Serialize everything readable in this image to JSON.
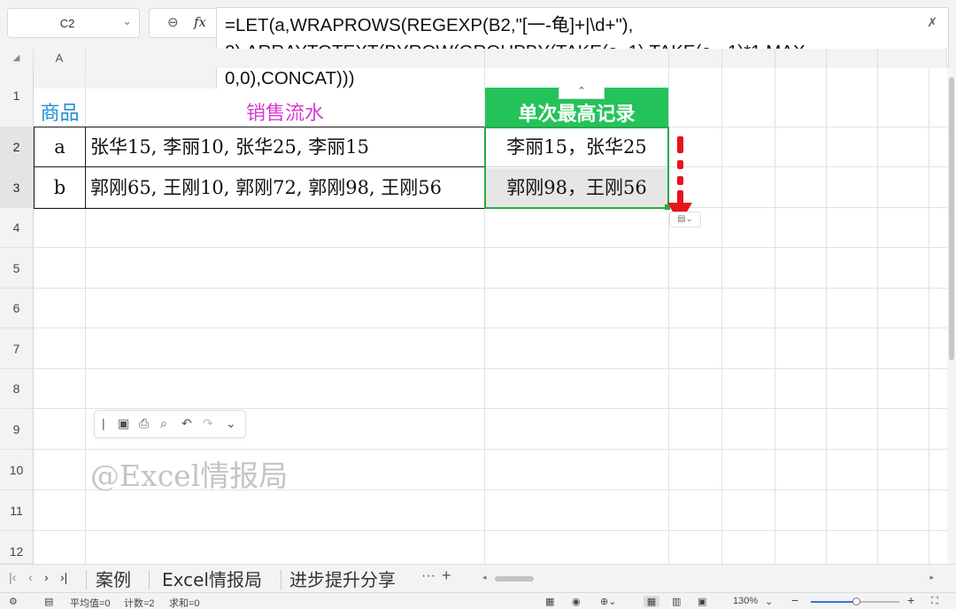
{
  "name_box": {
    "value": "C2"
  },
  "formula_bar": {
    "formula_line1": "=LET(a,WRAPROWS(REGEXP(B2,\"[一-龟]+|\\d+\"),",
    "formula_line2": "2),ARRAYTOTEXT(BYROW(GROUPBY(TAKE(a,,1),TAKE(a,,-1)*1,MAX,",
    "formula_line3": "0,0),CONCAT)))"
  },
  "columns": [
    "A"
  ],
  "rows": [
    "1",
    "2",
    "3",
    "4",
    "5",
    "6",
    "7",
    "8",
    "9",
    "10",
    "11",
    "12"
  ],
  "table": {
    "headers": {
      "product": "商品",
      "sales": "销售流水",
      "max_record": "单次最高记录"
    },
    "rows": [
      {
        "product": "a",
        "sales": "张华15, 李丽10, 张华25, 李丽15",
        "max_record": "李丽15，张华25"
      },
      {
        "product": "b",
        "sales": "郭刚65, 王刚10, 郭刚72, 郭刚98, 王刚56",
        "max_record": "郭刚98，王刚56"
      }
    ]
  },
  "watermark": "@Excel情报局",
  "sheet_tabs": [
    "案例",
    "Excel情报局",
    "进步提升分享"
  ],
  "tab_more": "···",
  "tab_add": "+",
  "status": {
    "average": "平均值=0",
    "count": "计数=2",
    "sum": "求和=0",
    "zoom": "130%"
  },
  "colors": {
    "header_product": "#1e8fd6",
    "header_sales": "#d63ad2",
    "header_max_bg": "#24c35a",
    "selection": "#2aa84a",
    "arrow": "#e8141b"
  }
}
